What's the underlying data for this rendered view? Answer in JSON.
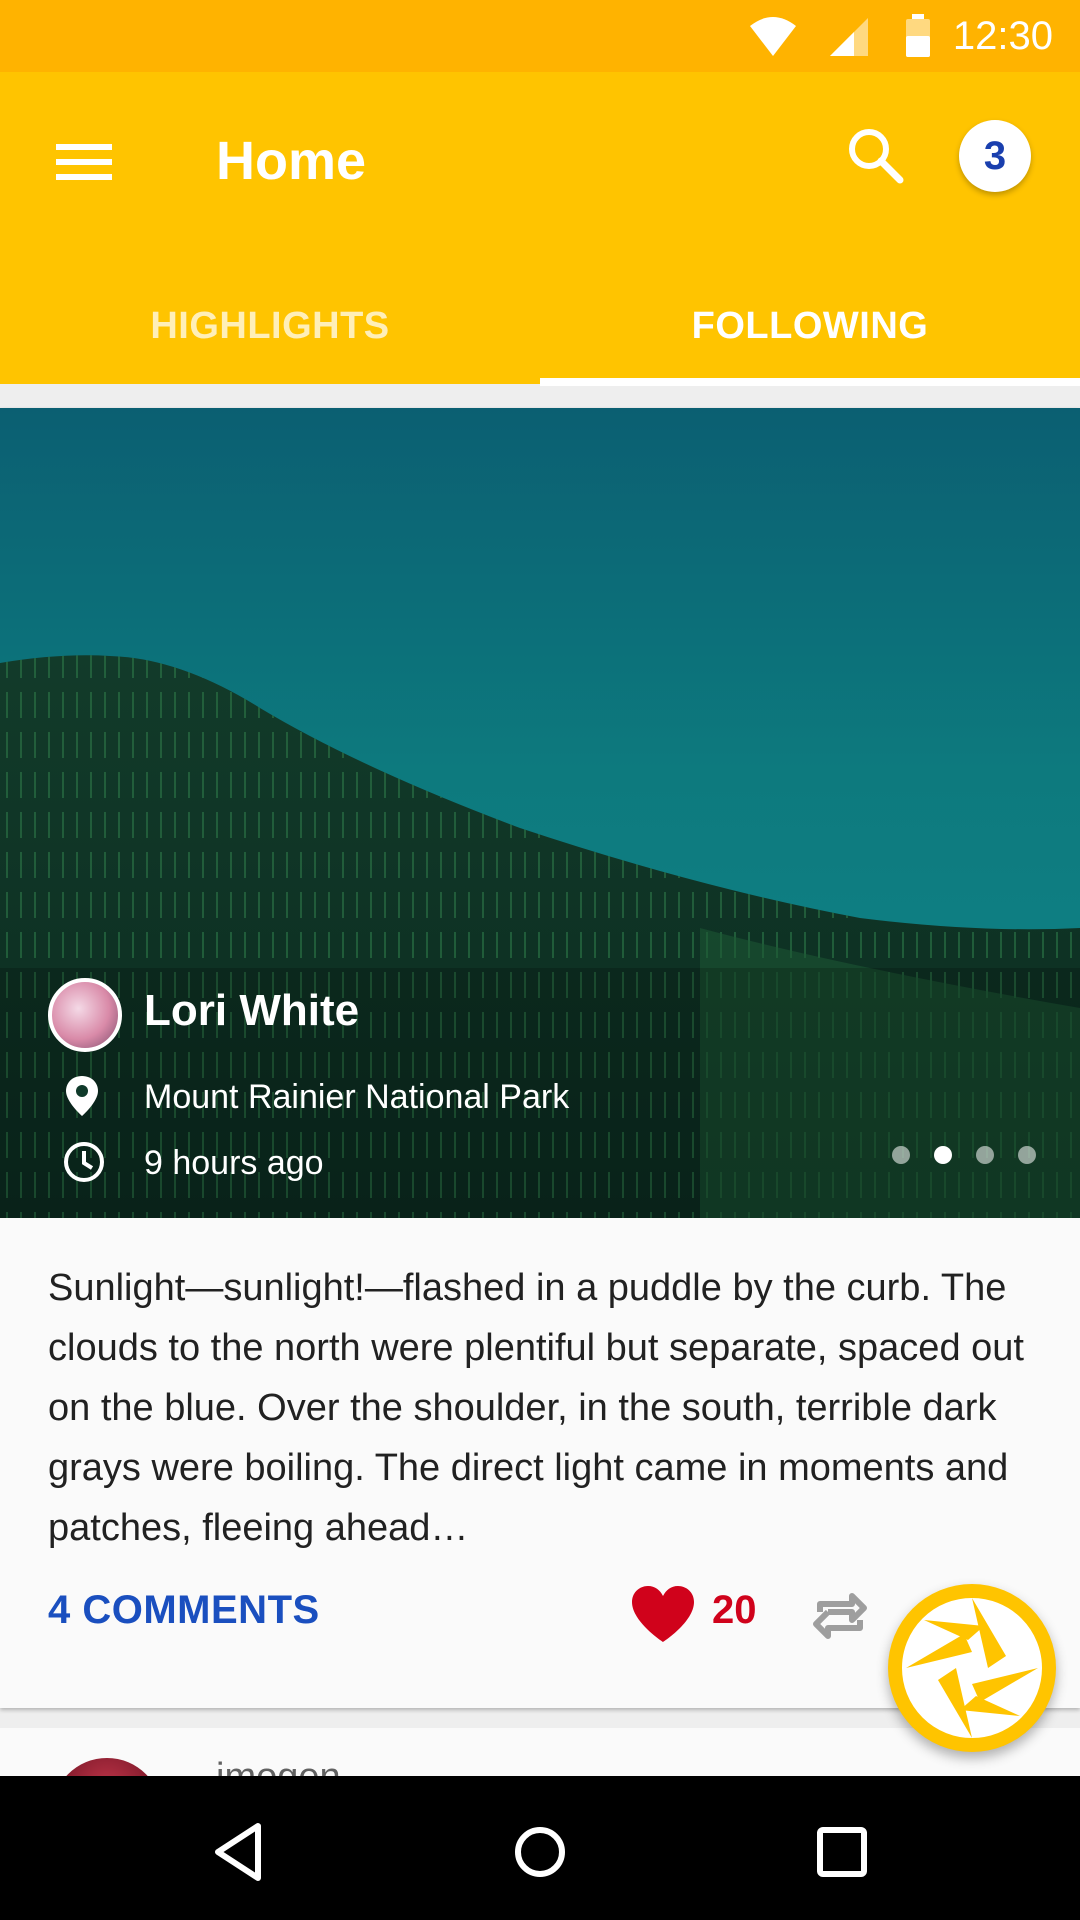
{
  "status_bar": {
    "time": "12:30",
    "icons": [
      "wifi-icon",
      "signal-icon",
      "battery-icon"
    ]
  },
  "app_bar": {
    "title": "Home",
    "menu_icon": "menu-icon",
    "search_icon": "search-icon",
    "notification_count": "3",
    "color": "#ffc400"
  },
  "tabs": [
    {
      "label": "HIGHLIGHTS",
      "selected": false
    },
    {
      "label": "FOLLOWING",
      "selected": true
    }
  ],
  "post": {
    "author": "Lori White",
    "location": "Mount Rainier National Park",
    "time_ago": "9 hours ago",
    "carousel": {
      "count": 4,
      "active_index": 1
    },
    "body": "Sunlight—sunlight!—flashed in a puddle by the curb. The clouds to the north were plentiful but separate, spaced out on the blue. Over the shoulder, in the south, terrible dark grays were boiling. The direct light came in moments and patches, fleeing ahead…",
    "comments_label": "4 COMMENTS",
    "likes": "20",
    "accent": "#1a4fbf",
    "like_color": "#d0021b"
  },
  "next_post": {
    "author_partial": "imogen"
  },
  "fab": {
    "icon": "camera-shutter-icon"
  },
  "nav_bar": {
    "icons": [
      "back-icon",
      "home-icon",
      "recents-icon"
    ]
  }
}
